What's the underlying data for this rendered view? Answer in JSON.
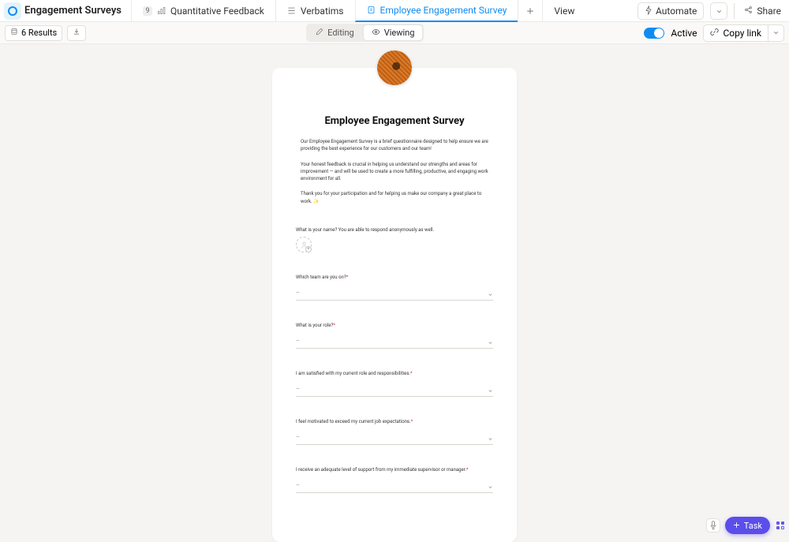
{
  "header": {
    "title": "Engagement Surveys",
    "automate": "Automate",
    "share": "Share",
    "view": "View"
  },
  "tabs": [
    {
      "label": "Quantitative Feedback",
      "badge": "9"
    },
    {
      "label": "Verbatims"
    },
    {
      "label": "Employee Engagement Survey"
    }
  ],
  "toolbar": {
    "results": "6 Results",
    "editing": "Editing",
    "viewing": "Viewing",
    "active": "Active",
    "copy_link": "Copy link"
  },
  "form": {
    "title": "Employee Engagement Survey",
    "para1": "Our Employee Engagement Survey is a brief questionnaire designed to help ensure we are providing the best experience for our customers and our team!",
    "para2": "Your honest feedback is crucial in helping us understand our strengths and areas for improvement — and will be used to create a more fulfilling, productive, and engaging work environment for all.",
    "para3": "Thank you for your participation and for helping us make our company a great place to work.  ✨",
    "q_name": "What is your name? You are able to respond anonymously as well.",
    "q_team": "Which team are you on?",
    "q_role": "What is your role?",
    "q_satisfied": "I am satisfied with my current role and responsibilities.",
    "q_motivated": "I feel motivated to exceed my current job expectations.",
    "q_support": "I receive an adequate level of support from my immediate supervisor or manager.",
    "placeholder_dash": "—",
    "required_mark": "*"
  },
  "fab": {
    "task": "Task"
  }
}
